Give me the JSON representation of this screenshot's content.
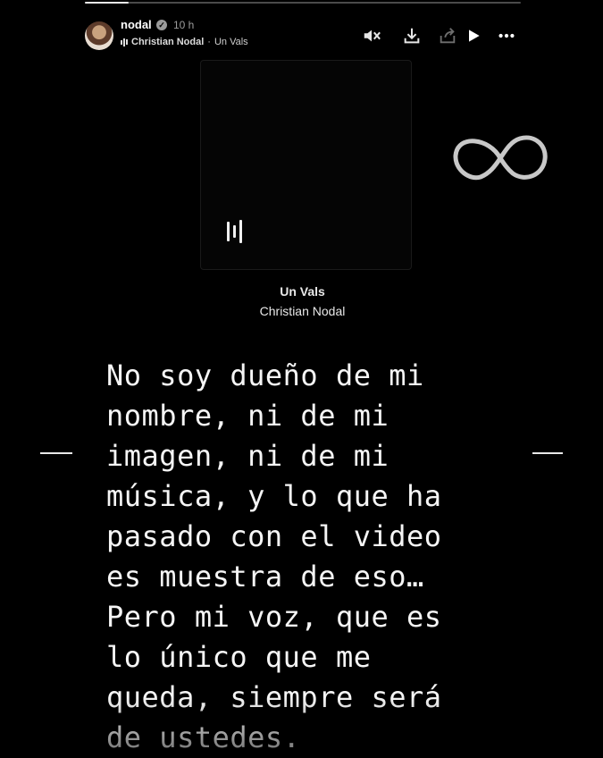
{
  "story": {
    "progress": 0.1,
    "username": "nodal",
    "verified_mark": "✓",
    "time_ago": "10 h",
    "music_artist": "Christian Nodal",
    "music_separator": "·",
    "music_song": "Un Vals"
  },
  "controls": {
    "icons": [
      "mute-icon",
      "download-icon",
      "share-icon",
      "play-icon",
      "more-icon"
    ]
  },
  "music_sticker": {
    "title": "Un Vals",
    "artist": "Christian Nodal"
  },
  "message": "No soy dueño de mi\nnombre, ni de mi\nimagen, ni de mi\nmúsica, y lo que ha\npasado con el video\nes muestra de eso…\nPero mi voz, que es\nlo único que me\nqueda, siempre será\nde ustedes.",
  "overlay": {
    "icon": "infinity-icon",
    "color": "#c8c8c8"
  }
}
